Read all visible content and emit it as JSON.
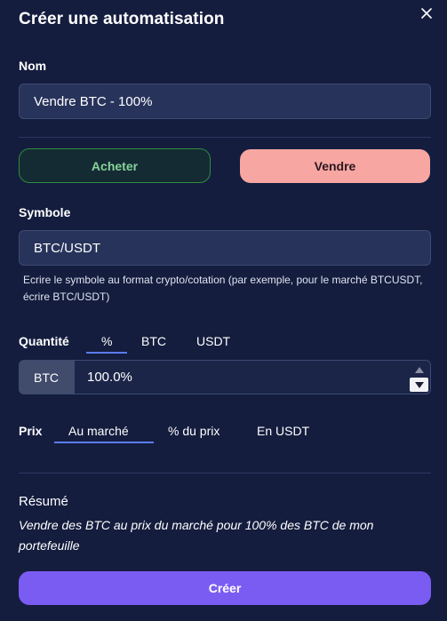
{
  "dialog": {
    "title": "Créer une automatisation",
    "close_icon": "close-icon"
  },
  "name_field": {
    "label": "Nom",
    "value": "Vendre BTC - 100%"
  },
  "side": {
    "buy_label": "Acheter",
    "sell_label": "Vendre",
    "selected": "Vendre"
  },
  "symbol_field": {
    "label": "Symbole",
    "value": "BTC/USDT",
    "hint": "Ecrire le symbole au format crypto/cotation (par exemple, pour le marché BTCUSDT, écrire BTC/USDT)"
  },
  "quantity": {
    "label": "Quantité",
    "tabs": [
      "%",
      "BTC",
      "USDT"
    ],
    "selected_tab": "%",
    "unit": "BTC",
    "value": "100.0%"
  },
  "price": {
    "label": "Prix",
    "tabs": [
      "Au marché",
      "% du prix",
      "En USDT"
    ],
    "selected_tab": "Au marché"
  },
  "summary": {
    "title": "Résumé",
    "text": "Vendre des BTC au prix du marché pour 100% des BTC de mon portefeuille"
  },
  "actions": {
    "create_label": "Créer"
  },
  "colors": {
    "background": "#141d3e",
    "buy_border": "#2e8b3f",
    "buy_text": "#86d39a",
    "sell_bg": "#f7a6a2",
    "create_bg": "#7b5cf2",
    "tab_underline": "#5b7cf5"
  }
}
